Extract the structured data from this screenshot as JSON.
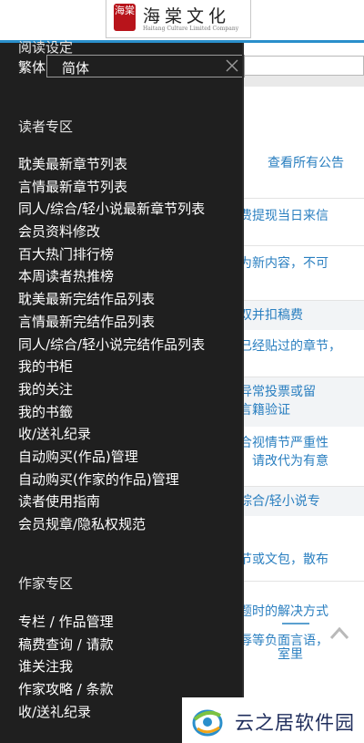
{
  "header": {
    "logo_seal": "海棠",
    "logo_main": "海棠文化",
    "logo_sub": "Haitang Culture Limited Company",
    "accent_color": "#2a8fcb"
  },
  "drawer": {
    "reading_setting": "阅读设定",
    "variant_label": "繁体",
    "variant_value": "简体",
    "reader_section": {
      "title": "读者专区",
      "items": [
        "耽美最新章节列表",
        "言情最新章节列表",
        "同人/综合/轻小说最新章节列表",
        "会员资料修改",
        "百大热门排行榜",
        "本周读者热推榜",
        "耽美最新完结作品列表",
        "言情最新完结作品列表",
        "同人/综合/轻小说完结作品列表",
        "我的书柜",
        "我的关注",
        "我的书籤",
        "收/送礼纪录",
        "自动购买(作品)管理",
        "自动购买(作家的作品)管理",
        "读者使用指南",
        "会员规章/隐私权规范"
      ]
    },
    "author_section": {
      "title": "作家专区",
      "items": [
        "专栏 / 作品管理",
        "稿费查询 / 请款",
        "谁关注我",
        "作家攻略 / 条款",
        "收/送礼纪录"
      ]
    }
  },
  "background": {
    "all_notices_link": "查看所有公告",
    "notices": [
      "费提现当日来信",
      "为新内容，不可",
      "双并扣稿费",
      "已经贴过的章节，",
      "异常投票或留",
      "言籍验证",
      "合视情节严重性",
      "请改代为有意",
      "综合/轻小说专",
      "节或文包，散布",
      "题时的解决方式",
      "辱等负面言语，",
      "室里"
    ]
  },
  "watermark": {
    "text": "云之居软件园"
  }
}
